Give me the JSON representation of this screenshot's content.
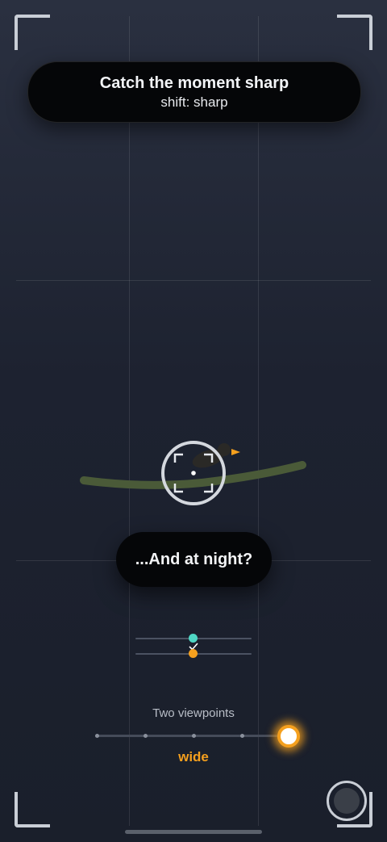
{
  "banner": {
    "title": "Catch the moment sharp",
    "subtitle": "shift: sharp"
  },
  "hint": {
    "text": "...And at night?"
  },
  "viewpoints": {
    "label": "Two viewpoints",
    "value_label": "wide",
    "level": 1.0
  },
  "colors": {
    "accent": "#f5a01e",
    "teal": "#4fd6c4",
    "branch": "#4a5a38",
    "bg": "#1d2230"
  },
  "icons": [
    "focus-reticle-icon",
    "bird-icon",
    "shutter-icon",
    "checkmark-icon"
  ]
}
